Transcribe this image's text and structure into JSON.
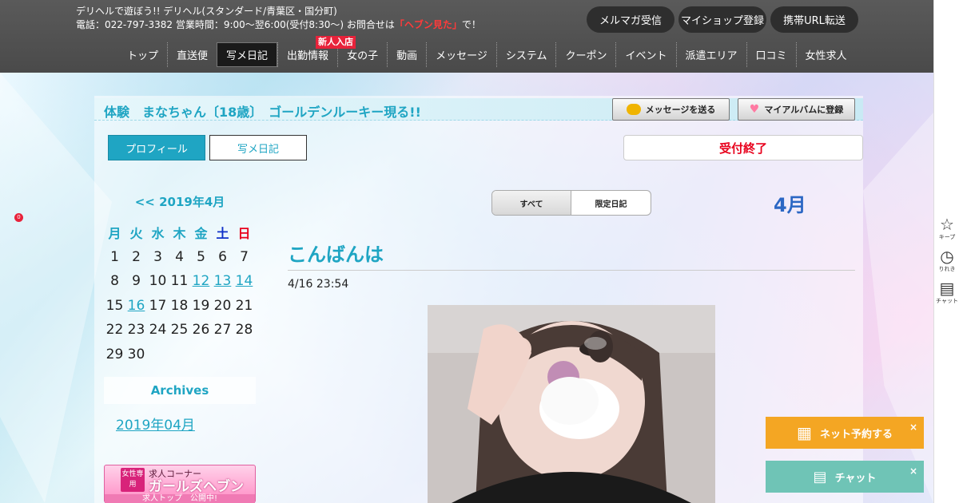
{
  "header": {
    "line1": "デリヘルで遊ぼう!! デリヘル(スタンダード/青葉区・国分町)",
    "line2_prefix": "電話：022-797-3382 営業時間：9:00～翌6:00(受付8:30～) お問合せは",
    "line2_highlight": "「ヘブン見た」",
    "line2_suffix": "で！",
    "buttons": [
      "メルマガ受信",
      "マイショップ登録",
      "携帯URL転送"
    ]
  },
  "nav": {
    "items": [
      "トップ",
      "直送便",
      "写メ日記",
      "出勤情報",
      "女の子",
      "動画",
      "メッセージ",
      "システム",
      "クーポン",
      "イベント",
      "派遣エリア",
      "口コミ",
      "女性求人"
    ],
    "active": "写メ日記",
    "badge": "新人入店"
  },
  "side_bar": {
    "keep_label": "キープ",
    "keep_count": "0",
    "history_label": "りれき",
    "chat_label": "チャット"
  },
  "profile": {
    "title": "体験　まなちゃん〔18歳〕　ゴールデンルーキー現る!!",
    "message_button": "メッセージを送る",
    "album_button": "マイアルバムに登録",
    "tabs": [
      "プロフィール",
      "写メ日記"
    ],
    "status": "受付終了"
  },
  "calendar": {
    "header": "<< 2019年4月",
    "weekdays": [
      "月",
      "火",
      "水",
      "木",
      "金",
      "土",
      "日"
    ],
    "weeks": [
      [
        "1",
        "2",
        "3",
        "4",
        "5",
        "6",
        "7"
      ],
      [
        "8",
        "9",
        "10",
        "11",
        "12",
        "13",
        "14"
      ],
      [
        "15",
        "16",
        "17",
        "18",
        "19",
        "20",
        "21"
      ],
      [
        "22",
        "23",
        "24",
        "25",
        "26",
        "27",
        "28"
      ],
      [
        "29",
        "30",
        "",
        "",
        "",
        "",
        ""
      ]
    ],
    "linked_days": [
      "12",
      "13",
      "14",
      "16"
    ]
  },
  "archives": {
    "heading": "Archives",
    "items": [
      "2019年04月"
    ]
  },
  "girls_heaven_banner": {
    "tag": "女性専用",
    "sub": "求人コーナー",
    "main": "ガールズヘブン",
    "bottom": "求人トップ　公開中!"
  },
  "filter": {
    "all": "すべて",
    "limited": "限定日記"
  },
  "month_label": "4月",
  "post": {
    "title": "こんばんは",
    "date": "4/16 23:54"
  },
  "floating": {
    "reserve": "ネット予約する",
    "chat": "チャット",
    "close": "×"
  },
  "colors": {
    "accent": "#1fa5c3",
    "header_bg": "#4f4f4f",
    "status_red": "#e8001c",
    "reserve_orange": "#f4a623",
    "chat_teal": "#6fc4b6",
    "month_blue": "#2b67c4"
  }
}
